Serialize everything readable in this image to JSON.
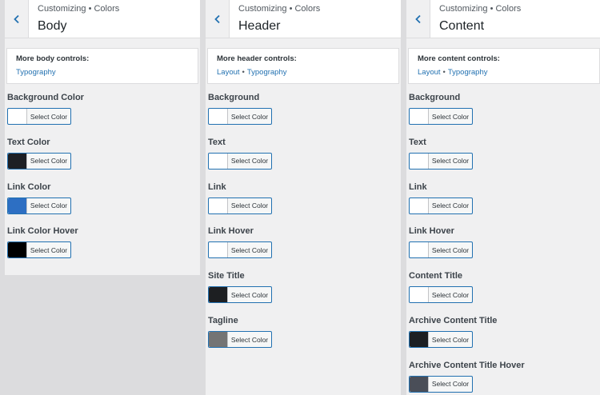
{
  "panels": [
    {
      "crumb": "Customizing • Colors",
      "title": "Body",
      "more_title": "More body controls:",
      "links": [
        "Typography"
      ],
      "controls": [
        {
          "label": "Background Color",
          "button": "Select Color",
          "color": "#ffffff"
        },
        {
          "label": "Text Color",
          "button": "Select Color",
          "color": "#1d1f24"
        },
        {
          "label": "Link Color",
          "button": "Select Color",
          "color": "#2d6fc3"
        },
        {
          "label": "Link Color Hover",
          "button": "Select Color",
          "color": "#000000"
        }
      ]
    },
    {
      "crumb": "Customizing • Colors",
      "title": "Header",
      "more_title": "More header controls:",
      "links": [
        "Layout",
        "Typography"
      ],
      "controls": [
        {
          "label": "Background",
          "button": "Select Color",
          "color": "#ffffff"
        },
        {
          "label": "Text",
          "button": "Select Color",
          "color": "#ffffff"
        },
        {
          "label": "Link",
          "button": "Select Color",
          "color": "#ffffff"
        },
        {
          "label": "Link Hover",
          "button": "Select Color",
          "color": "#ffffff"
        },
        {
          "label": "Site Title",
          "button": "Select Color",
          "color": "#1d1f22"
        },
        {
          "label": "Tagline",
          "button": "Select Color",
          "color": "#747474"
        }
      ]
    },
    {
      "crumb": "Customizing • Colors",
      "title": "Content",
      "more_title": "More content controls:",
      "links": [
        "Layout",
        "Typography"
      ],
      "controls": [
        {
          "label": "Background",
          "button": "Select Color",
          "color": "#ffffff"
        },
        {
          "label": "Text",
          "button": "Select Color",
          "color": "#ffffff"
        },
        {
          "label": "Link",
          "button": "Select Color",
          "color": "#ffffff"
        },
        {
          "label": "Link Hover",
          "button": "Select Color",
          "color": "#ffffff"
        },
        {
          "label": "Content Title",
          "button": "Select Color",
          "color": "#ffffff"
        },
        {
          "label": "Archive Content Title",
          "button": "Select Color",
          "color": "#1d1f22"
        },
        {
          "label": "Archive Content Title Hover",
          "button": "Select Color",
          "color": "#4a4e58"
        }
      ]
    }
  ],
  "separator": "•",
  "accent": "#2271b1"
}
